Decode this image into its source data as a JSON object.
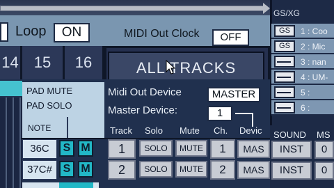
{
  "loop": {
    "label": "Loop",
    "value": "ON"
  },
  "midi_clock": {
    "label": "MIDI Out Clock",
    "value": "OFF"
  },
  "track_numbers": [
    "14",
    "15",
    "16"
  ],
  "all_tracks": "ALL TRACKS",
  "pad": {
    "mute": "PAD MUTE",
    "solo": "PAD SOLO",
    "note": "NOTE"
  },
  "midi_out_device": {
    "label": "Midi Out Device",
    "value": "MASTER"
  },
  "master_device": {
    "label": "Master Device:",
    "value": "1"
  },
  "columns": [
    "Track",
    "Solo",
    "Mute",
    "Ch.",
    "Devic"
  ],
  "rows": [
    {
      "note": "36C",
      "s": "S",
      "m": "M",
      "track": "1",
      "solo": "SOLO",
      "mute": "MUTE",
      "ch": "1",
      "dev": "MAS"
    },
    {
      "note": "37C#",
      "s": "S",
      "m": "M",
      "track": "2",
      "solo": "SOLO",
      "mute": "MUTE",
      "ch": "2",
      "dev": "MAS"
    }
  ],
  "gsxg": {
    "title": "GS/XG",
    "items": [
      {
        "btn": "GS",
        "label": "1 : Coo"
      },
      {
        "btn": "GS",
        "label": "2 : Mic"
      },
      {
        "btn": "",
        "label": "3 : nan"
      },
      {
        "btn": "",
        "label": "4 : UM-"
      },
      {
        "btn": "",
        "label": "5 :"
      },
      {
        "btn": "",
        "label": "6 :"
      }
    ]
  },
  "sound": {
    "headers": [
      "SOUND",
      "MS"
    ],
    "values": [
      "INST",
      "INST"
    ],
    "ms_values": [
      "0",
      "0"
    ]
  },
  "colors": {
    "accent": "#22b8c6",
    "panel": "#7e97b2",
    "background": "#1a2440"
  }
}
